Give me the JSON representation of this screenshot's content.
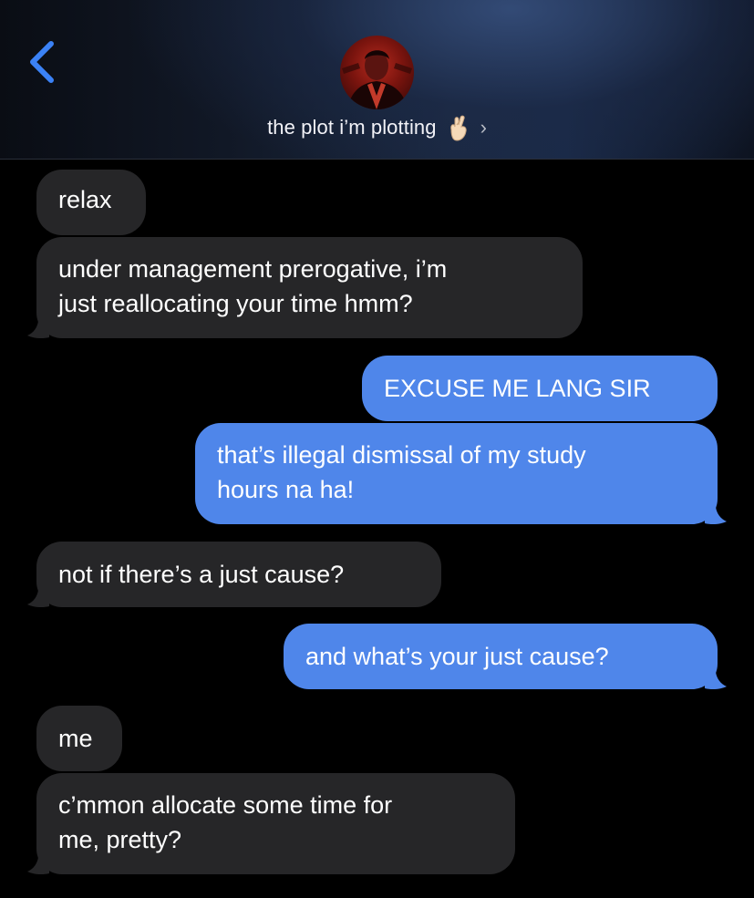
{
  "header": {
    "back_icon": "chevron-left-icon",
    "contact_name": "the plot i’m plotting",
    "contact_emoji": "crossed-fingers-icon",
    "details_icon": "chevron-right-icon",
    "details_glyph": "›"
  },
  "colors": {
    "received_bubble": "#262628",
    "sent_bubble": "#4f86ea",
    "accent": "#3b82f6",
    "background": "#000000"
  },
  "messages": [
    {
      "side": "received",
      "text": "relax"
    },
    {
      "side": "received",
      "lines": [
        "under management prerogative, i’m",
        "just reallocating your time hmm?"
      ]
    },
    {
      "side": "sent",
      "text": "EXCUSE ME LANG SIR"
    },
    {
      "side": "sent",
      "lines": [
        "that’s illegal dismissal of my study",
        "hours na ha!"
      ]
    },
    {
      "side": "received",
      "text": "not if there’s a just cause?"
    },
    {
      "side": "sent",
      "text": "and what’s your just cause?"
    },
    {
      "side": "received",
      "text": "me"
    },
    {
      "side": "received",
      "lines": [
        "c’mmon allocate some time for",
        "me, pretty?"
      ]
    }
  ]
}
